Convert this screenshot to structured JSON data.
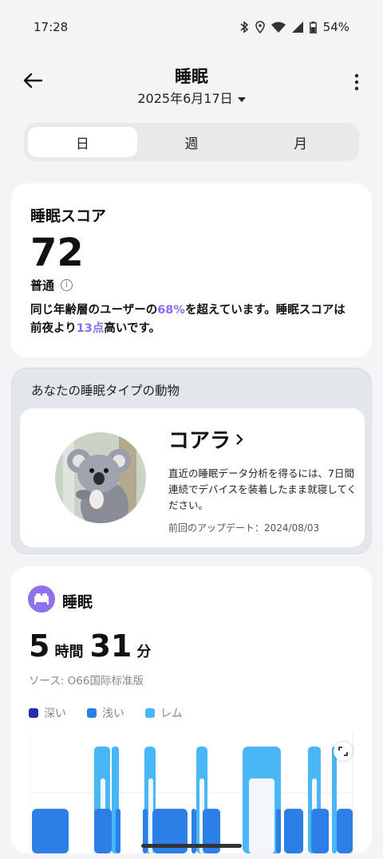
{
  "status_bar": {
    "time": "17:28",
    "battery": "54%"
  },
  "header": {
    "title": "睡眠",
    "date": "2025年6月17日"
  },
  "tabs": [
    {
      "label": "日",
      "active": true
    },
    {
      "label": "週",
      "active": false
    },
    {
      "label": "月",
      "active": false
    }
  ],
  "score_card": {
    "label": "睡眠スコア",
    "value": "72",
    "level": "普通",
    "desc_part1": "同じ年齢層のユーザーの",
    "desc_pct": "68%",
    "desc_part2": "を超えています。睡眠スコアは前夜より",
    "desc_pts": "13点",
    "desc_part3": "高いです。",
    "accent_color": "#8a6df0"
  },
  "animal": {
    "header": "あなたの睡眠タイプの動物",
    "name": "コアラ",
    "description": "直近の睡眠データ分析を得るには、7日間連続でデバイスを装着したまま就寝してください。",
    "updated": "前回のアップデート：2024/08/03"
  },
  "sleep": {
    "title": "睡眠",
    "hours": "5",
    "hours_unit": "時間",
    "minutes": "31",
    "minutes_unit": "分",
    "source": "ソース: O66国际标准版",
    "legend": [
      {
        "label": "深い",
        "color": "#2a2fa8"
      },
      {
        "label": "浅い",
        "color": "#2d7fe8"
      },
      {
        "label": "レム",
        "color": "#49b6f5"
      }
    ]
  }
}
